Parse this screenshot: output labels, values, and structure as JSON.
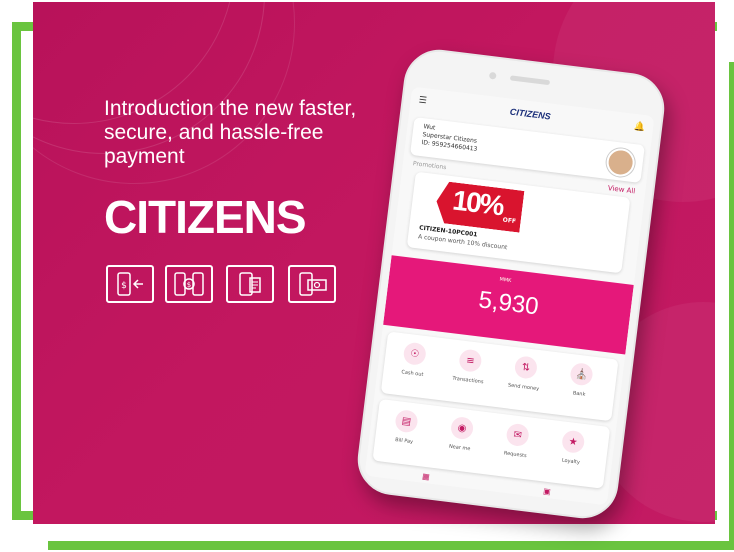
{
  "headline": "Introduction the new faster, secure, and hassle-free payment",
  "brand": "CITIZENS",
  "features": [
    {
      "icon": "cash-transfer-phone-icon"
    },
    {
      "icon": "currency-exchange-phones-icon"
    },
    {
      "icon": "phone-receipt-icon"
    },
    {
      "icon": "phone-banknote-icon"
    }
  ],
  "app": {
    "logo": "CITIZENS",
    "user": {
      "greeting": "Wut",
      "name": "Superstar Citizens",
      "id": "ID: 959254660413"
    },
    "promotions_label": "Promotions",
    "view_all": "View All",
    "coupon": {
      "percent": "10%",
      "off": "OFF",
      "code": "CITIZEN-10PC001",
      "description": "A coupon worth 10% discount"
    },
    "balance": {
      "label": "MMK",
      "value": "5,930"
    },
    "actions": [
      {
        "label": "Cash out",
        "icon": "cash-out-icon"
      },
      {
        "label": "Transactions",
        "icon": "list-icon"
      },
      {
        "label": "Send money",
        "icon": "send-icon"
      },
      {
        "label": "Bank",
        "icon": "bank-icon"
      }
    ],
    "actions2": [
      {
        "label": "Bill Pay",
        "icon": "bill-icon"
      },
      {
        "label": "Near me",
        "icon": "location-icon"
      },
      {
        "label": "Requests",
        "icon": "request-icon"
      },
      {
        "label": "Loyalty",
        "icon": "loyalty-icon"
      }
    ]
  },
  "colors": {
    "panel": "#c2175f",
    "frame": "#6ac43f",
    "accent": "#e5187a"
  }
}
